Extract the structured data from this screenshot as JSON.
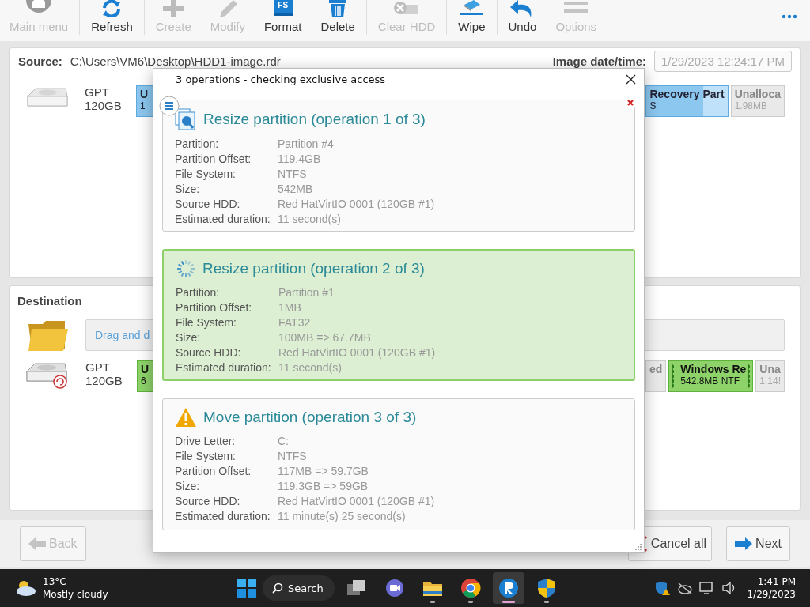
{
  "toolbar": {
    "items": [
      {
        "kind": "home",
        "label": "Main menu",
        "disabled": true,
        "separator_after": true
      },
      {
        "kind": "refresh",
        "label": "Refresh",
        "disabled": false,
        "separator_after": true
      },
      {
        "kind": "create",
        "label": "Create",
        "disabled": true,
        "separator_after": false
      },
      {
        "kind": "modify",
        "label": "Modify",
        "disabled": true,
        "separator_after": false
      },
      {
        "kind": "format",
        "label": "Format",
        "disabled": false,
        "separator_after": false,
        "badge": "FS"
      },
      {
        "kind": "delete",
        "label": "Delete",
        "disabled": false,
        "separator_after": true
      },
      {
        "kind": "clear",
        "label": "Clear HDD",
        "disabled": true,
        "separator_after": true
      },
      {
        "kind": "wipe",
        "label": "Wipe",
        "disabled": false,
        "separator_after": true
      },
      {
        "kind": "undo",
        "label": "Undo",
        "disabled": false,
        "separator_after": false
      },
      {
        "kind": "options",
        "label": "Options",
        "disabled": true,
        "separator_after": false
      }
    ]
  },
  "source": {
    "label": "Source:",
    "path": "C:\\Users\\VM6\\Desktop\\HDD1-image.rdr",
    "date_label": "Image date/time:",
    "date_value": "1/29/2023 12:24:17 PM",
    "disk": {
      "type": "GPT",
      "size": "120GB",
      "left": [
        {
          "kind": "blue",
          "title": "U",
          "detail": "1"
        }
      ],
      "right": [
        {
          "kind": "blue",
          "title": "Recovery Part",
          "detail": "S",
          "level": 0.3
        },
        {
          "kind": "free",
          "title": "Unalloca",
          "detail": "1.98MB"
        }
      ]
    }
  },
  "destination": {
    "title": "Destination",
    "drop_hint": "Drag and d",
    "disk": {
      "type": "GPT",
      "size": "120GB",
      "left": [
        {
          "kind": "green",
          "title": "U",
          "detail": "6"
        }
      ],
      "right": [
        {
          "kind": "free",
          "title": "ed"
        },
        {
          "kind": "green-handles",
          "title": "Windows Re",
          "detail": "542.8MB NTF"
        },
        {
          "kind": "free",
          "title": "Una",
          "detail": "1.14!"
        }
      ]
    }
  },
  "bottom_bar": {
    "back": {
      "label": "Back",
      "disabled": true
    },
    "cancel": {
      "label": "Cancel all"
    },
    "next": {
      "label": "Next"
    }
  },
  "dialog": {
    "title": "3 operations - checking exclusive access",
    "operations": [
      {
        "kind": "resize",
        "active": false,
        "title": "Resize partition (operation 1 of 3)",
        "fields": [
          {
            "label": "Partition:",
            "value": "Partition #4"
          },
          {
            "label": "Partition Offset:",
            "value": "119.4GB"
          },
          {
            "label": "File System:",
            "value": "NTFS"
          },
          {
            "label": "Size:",
            "value": "542MB"
          },
          {
            "label": "Source HDD:",
            "value": "Red HatVirtIO 0001 (120GB #1)"
          },
          {
            "label": "Estimated duration:",
            "value": "11 second(s)"
          }
        ]
      },
      {
        "kind": "progress",
        "active": true,
        "title": "Resize partition (operation 2 of 3)",
        "fields": [
          {
            "label": "Partition:",
            "value": "Partition #1"
          },
          {
            "label": "Partition Offset:",
            "value": "1MB"
          },
          {
            "label": "File System:",
            "value": "FAT32"
          },
          {
            "label": "Size:",
            "value": "100MB => 67.7MB"
          },
          {
            "label": "Source HDD:",
            "value": "Red HatVirtIO 0001 (120GB #1)"
          },
          {
            "label": "Estimated duration:",
            "value": "11 second(s)"
          }
        ]
      },
      {
        "kind": "warning",
        "active": false,
        "title": "Move partition (operation 3 of 3)",
        "fields": [
          {
            "label": "Drive Letter:",
            "value": "C:"
          },
          {
            "label": "File System:",
            "value": "NTFS"
          },
          {
            "label": "Partition Offset:",
            "value": "117MB => 59.7GB"
          },
          {
            "label": "Size:",
            "value": "119.3GB => 59GB"
          },
          {
            "label": "Source HDD:",
            "value": "Red HatVirtIO 0001 (120GB #1)"
          },
          {
            "label": "Estimated duration:",
            "value": "11 minute(s) 25 second(s)"
          }
        ]
      }
    ]
  },
  "taskbar": {
    "weather": {
      "temperature": "13°C",
      "condition": "Mostly cloudy"
    },
    "search": "Search",
    "apps": [
      {
        "kind": "taskview",
        "running": false,
        "selected": false
      },
      {
        "kind": "chat",
        "running": false,
        "selected": false
      },
      {
        "kind": "explorer",
        "running": true,
        "selected": false
      },
      {
        "kind": "chrome",
        "running": true,
        "selected": false
      },
      {
        "kind": "rapp",
        "running": true,
        "selected": true
      },
      {
        "kind": "shield",
        "running": true,
        "selected": false
      }
    ],
    "time": "1:41 PM",
    "date": "1/29/2023"
  }
}
